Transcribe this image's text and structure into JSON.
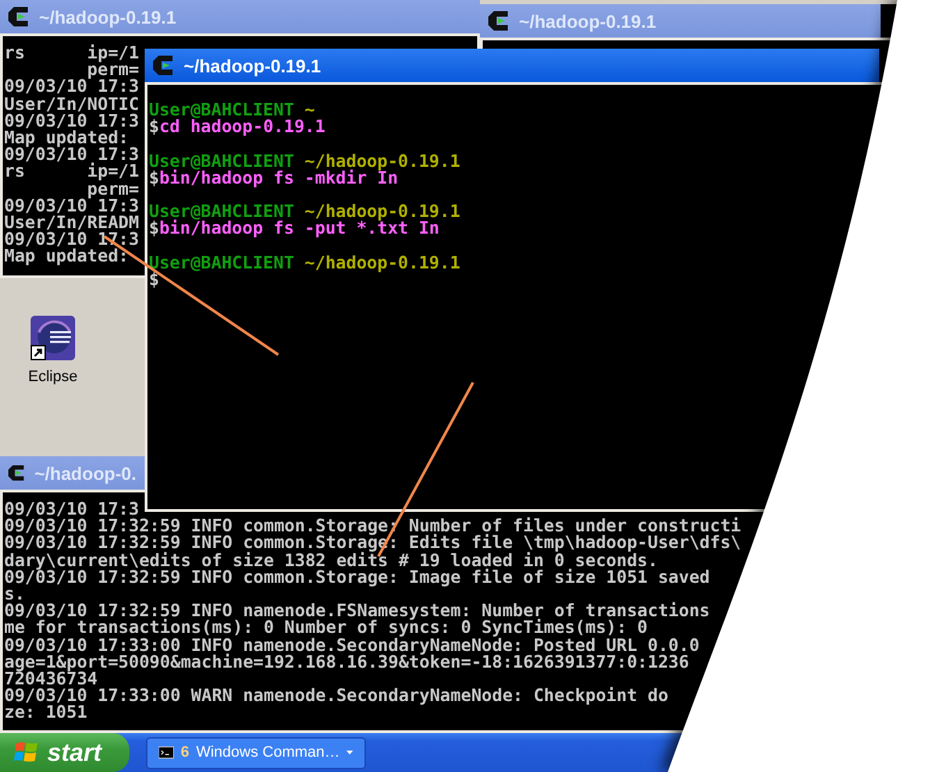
{
  "desktop_icons": [
    {
      "label": "Eclipse",
      "shortcut": true
    }
  ],
  "windows": [
    {
      "title": "~/hadoop-0.19.1",
      "active": false,
      "lines": [
        {
          "kind": "log",
          "text": "rs      ip=/1"
        },
        {
          "kind": "log",
          "text": "        perm="
        },
        {
          "kind": "log",
          "text": "09/03/10 17:3"
        },
        {
          "kind": "log",
          "text": "User/In/NOTIC"
        },
        {
          "kind": "log",
          "text": "09/03/10 17:3"
        },
        {
          "kind": "log",
          "text": "Map updated:"
        },
        {
          "kind": "log",
          "text": "09/03/10 17:3"
        },
        {
          "kind": "log",
          "text": "rs      ip=/1"
        },
        {
          "kind": "log",
          "text": "        perm="
        },
        {
          "kind": "log",
          "text": "09/03/10 17:3"
        },
        {
          "kind": "log",
          "text": "User/In/READM"
        },
        {
          "kind": "log",
          "text": "09/03/10 17:3"
        },
        {
          "kind": "log",
          "text": "Map updated:"
        }
      ]
    },
    {
      "title": "~/hadoop-0.19.1",
      "active": false
    },
    {
      "title": "~/hadoop-0.",
      "active": false,
      "lines": [
        {
          "kind": "log",
          "text": "09/03/10 17:3"
        },
        {
          "kind": "log",
          "text": "09/03/10 17:32:59 INFO common.Storage: Number of files under constructi"
        },
        {
          "kind": "log",
          "text": "09/03/10 17:32:59 INFO common.Storage: Edits file \\tmp\\hadoop-User\\dfs\\"
        },
        {
          "kind": "log",
          "text": "dary\\current\\edits of size 1382 edits # 19 loaded in 0 seconds."
        },
        {
          "kind": "log",
          "text": "09/03/10 17:32:59 INFO common.Storage: Image file of size 1051 saved"
        },
        {
          "kind": "log",
          "text": "s."
        },
        {
          "kind": "log",
          "text": "09/03/10 17:32:59 INFO namenode.FSNamesystem: Number of transactions"
        },
        {
          "kind": "log",
          "text": "me for transactions(ms): 0 Number of syncs: 0 SyncTimes(ms): 0"
        },
        {
          "kind": "log",
          "text": "09/03/10 17:33:00 INFO namenode.SecondaryNameNode: Posted URL 0.0.0"
        },
        {
          "kind": "log",
          "text": "age=1&port=50090&machine=192.168.16.39&token=-18:1626391377:0:1236"
        },
        {
          "kind": "log",
          "text": "720436734"
        },
        {
          "kind": "log",
          "text": "09/03/10 17:33:00 WARN namenode.SecondaryNameNode: Checkpoint do"
        },
        {
          "kind": "log",
          "text": "ze: 1051"
        }
      ]
    },
    {
      "title": "~/hadoop-0.19.1",
      "active": true,
      "lines": [
        {
          "kind": "prompt",
          "user": "User@BAHCLIENT",
          "path": "~"
        },
        {
          "kind": "command",
          "sign": "$",
          "text": "cd hadoop-0.19.1"
        },
        {
          "kind": "blank"
        },
        {
          "kind": "prompt",
          "user": "User@BAHCLIENT",
          "path": "~/hadoop-0.19.1"
        },
        {
          "kind": "command",
          "sign": "$",
          "text": "bin/hadoop fs -mkdir In"
        },
        {
          "kind": "blank"
        },
        {
          "kind": "prompt",
          "user": "User@BAHCLIENT",
          "path": "~/hadoop-0.19.1"
        },
        {
          "kind": "command",
          "sign": "$",
          "text": "bin/hadoop fs -put *.txt In"
        },
        {
          "kind": "blank"
        },
        {
          "kind": "prompt",
          "user": "User@BAHCLIENT",
          "path": "~/hadoop-0.19.1"
        },
        {
          "kind": "command",
          "sign": "$"
        }
      ]
    }
  ],
  "taskbar": {
    "start_label": "start",
    "buttons": [
      {
        "count": "6",
        "label": "Windows Comman…",
        "selected": false
      }
    ]
  }
}
